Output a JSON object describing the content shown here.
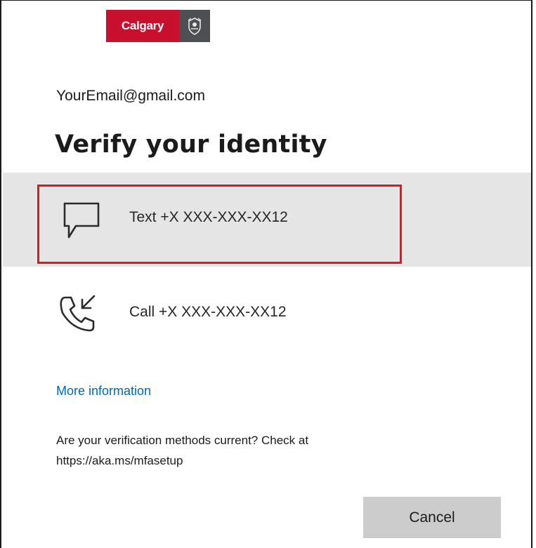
{
  "logo": {
    "text": "Calgary",
    "brand_color": "#c8102e",
    "crest_color": "#4e4f52",
    "crest_icon": "city-crest-icon"
  },
  "account": {
    "email": "YourEmail@gmail.com"
  },
  "page": {
    "title": "Verify your identity"
  },
  "methods": [
    {
      "icon": "chat-bubble-icon",
      "label": "Text +X XXX-XXX-XX12",
      "selected": true
    },
    {
      "icon": "phone-incoming-icon",
      "label": "Call +X XXX-XXX-XX12",
      "selected": false
    }
  ],
  "links": {
    "more_info": "More information"
  },
  "notice": {
    "line1": "Are your verification methods current? Check at",
    "line2": "https://aka.ms/mfasetup"
  },
  "buttons": {
    "cancel": "Cancel"
  },
  "colors": {
    "selected_bg": "#e5e5e5",
    "highlight_border": "#e8141c",
    "link": "#0067b8",
    "button_bg": "#cccccc"
  }
}
